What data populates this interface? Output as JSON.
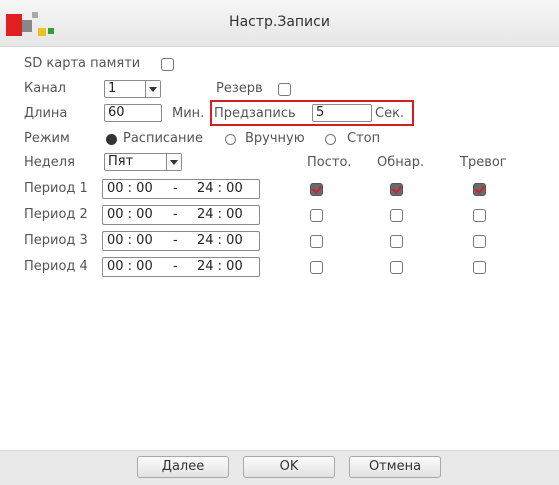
{
  "window": {
    "title": "Настр.Записи",
    "logo_colors": [
      "#e02020",
      "#f0c020",
      "#30a030",
      "#888888"
    ]
  },
  "form": {
    "sd_card_label": "SD карта памяти",
    "channel_label": "Канал",
    "channel_value": "1",
    "reserve_label": "Резерв",
    "length_label": "Длина",
    "length_value": "60",
    "length_unit": "Мин.",
    "prerecord_label": "Предзапись",
    "prerecord_value": "5",
    "prerecord_unit": "Сек.",
    "mode_label": "Режим",
    "mode_options": [
      "Расписание",
      "Вручную",
      "Стоп"
    ],
    "mode_selected": "Расписание",
    "week_label": "Неделя",
    "week_value": "Пят"
  },
  "schedule": {
    "columns": [
      "Посто.",
      "Обнар.",
      "Тревог"
    ],
    "periods": [
      {
        "label": "Период 1",
        "start": "00 : 00",
        "sep": "-",
        "end": "24 : 00",
        "checks": [
          true,
          true,
          true
        ]
      },
      {
        "label": "Период 2",
        "start": "00 : 00",
        "sep": "-",
        "end": "24 : 00",
        "checks": [
          false,
          false,
          false
        ]
      },
      {
        "label": "Период 3",
        "start": "00 : 00",
        "sep": "-",
        "end": "24 : 00",
        "checks": [
          false,
          false,
          false
        ]
      },
      {
        "label": "Период 4",
        "start": "00 : 00",
        "sep": "-",
        "end": "24 : 00",
        "checks": [
          false,
          false,
          false
        ]
      }
    ]
  },
  "buttons": {
    "next": "Далее",
    "ok": "OK",
    "cancel": "Отмена"
  },
  "colors": {
    "highlight": "#d02020",
    "check_mark": "#c23"
  }
}
